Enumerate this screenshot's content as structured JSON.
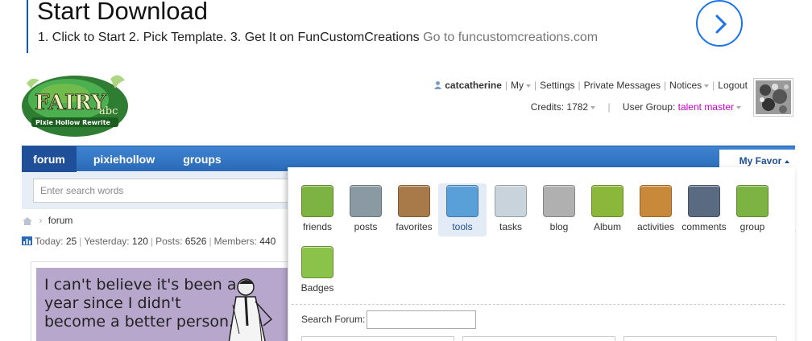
{
  "ad": {
    "title": "Start Download",
    "subtitle": "1. Click to Start 2. Pick Template. 3. Get It on FunCustomCreations",
    "link": "Go to funcustomcreations.com"
  },
  "logo": {
    "word1": "FAIRY",
    "word2": "abc",
    "tagline": "Pixie Hollow Rewrite"
  },
  "userbar": {
    "username": "catcatherine",
    "my": "My",
    "settings": "Settings",
    "messages": "Private Messages",
    "notices": "Notices",
    "logout": "Logout",
    "credits_label": "Credits:",
    "credits_value": "1782",
    "group_label": "User Group:",
    "group_value": "talent master"
  },
  "nav": {
    "tabs": [
      {
        "label": "forum"
      },
      {
        "label": "pixiehollow"
      },
      {
        "label": "groups"
      }
    ],
    "my_favor": "My Favor"
  },
  "search": {
    "placeholder": "Enter search words"
  },
  "breadcrumb": {
    "current": "forum"
  },
  "stats": {
    "today_label": "Today:",
    "today": "25",
    "yesterday_label": "Yesterday:",
    "yesterday": "120",
    "posts_label": "Posts:",
    "posts": "6526",
    "members_label": "Members:",
    "members": "440"
  },
  "ecard": {
    "text": "I can't believe it's been a year since I didn't become a better person."
  },
  "panel": {
    "apps": [
      {
        "label": "friends",
        "color": "#7cb342"
      },
      {
        "label": "posts",
        "color": "#8a9aa2"
      },
      {
        "label": "favorites",
        "color": "#a87a4a"
      },
      {
        "label": "tools",
        "color": "#5aa0d8"
      },
      {
        "label": "tasks",
        "color": "#c9d3dc"
      },
      {
        "label": "blog",
        "color": "#b0b0b0"
      },
      {
        "label": "Album",
        "color": "#8bb83a"
      },
      {
        "label": "activities",
        "color": "#c88a3a"
      },
      {
        "label": "comments",
        "color": "#5a6a80"
      },
      {
        "label": "group",
        "color": "#7cb342"
      },
      {
        "label": "Badges",
        "color": "#8bc34a"
      }
    ],
    "search_label": "Search Forum:"
  },
  "right_partial": "group"
}
